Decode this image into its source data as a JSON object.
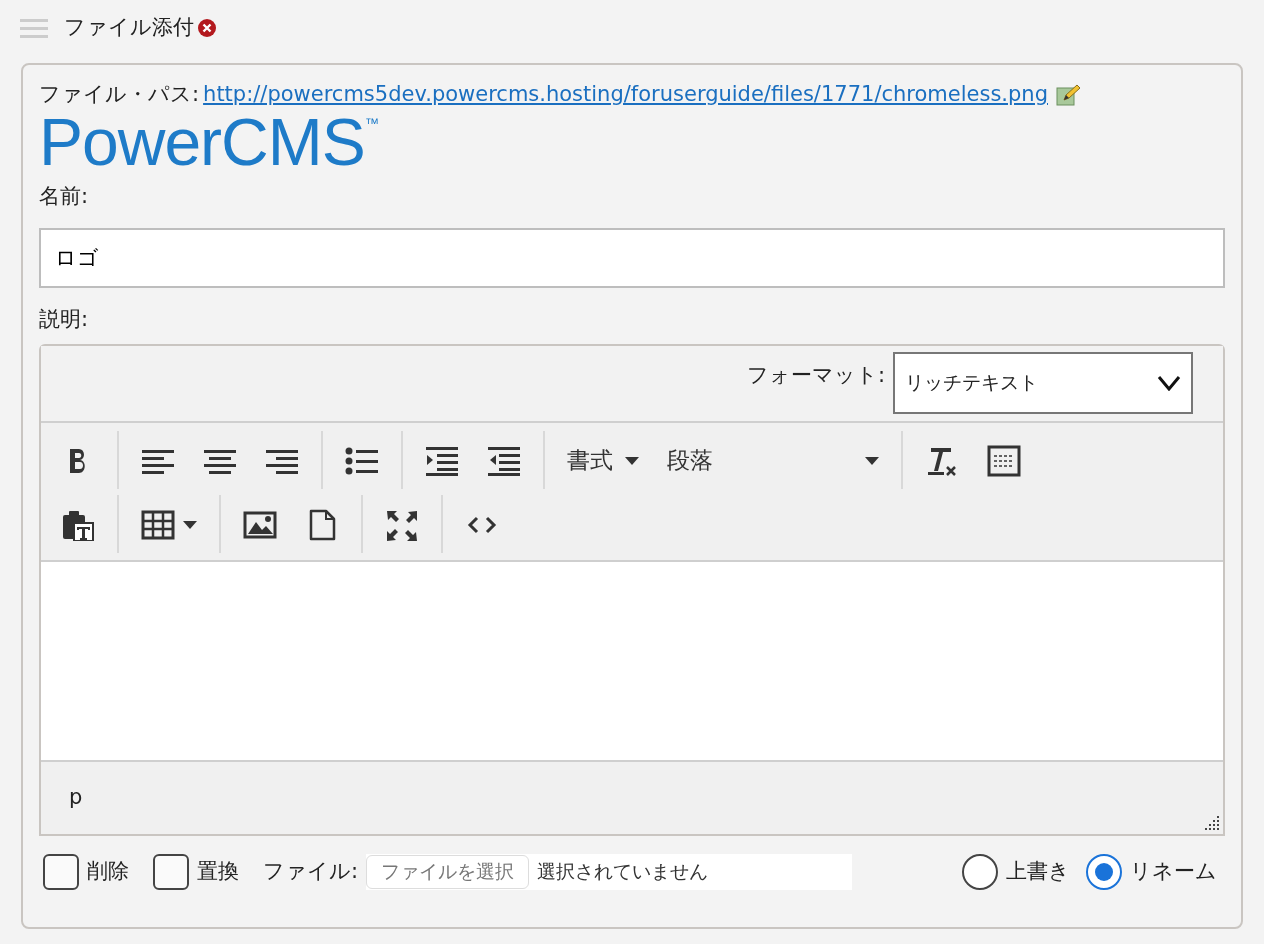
{
  "header": {
    "title": "ファイル添付"
  },
  "file_path": {
    "label": "ファイル・パス:",
    "url": "http://powercms5dev.powercms.hosting/foruserguide/files/1771/chromeless.png"
  },
  "preview_logo": {
    "text": "PowerCMS",
    "mark": "™"
  },
  "name_field": {
    "label": "名前:",
    "value": "ロゴ"
  },
  "description": {
    "label": "説明:",
    "format_label": "フォーマット:",
    "format_value": "リッチテキスト",
    "toolbar_menus": [
      "書式",
      "段落"
    ],
    "status_path": "p"
  },
  "options": [
    {
      "kind": "checkbox",
      "label": "削除",
      "checked": false
    },
    {
      "kind": "checkbox",
      "label": "置換",
      "checked": false
    }
  ],
  "file_input": {
    "label": "ファイル:",
    "button": "ファイルを選択",
    "status": "選択されていません"
  },
  "save_mode": [
    {
      "label": "上書き",
      "selected": false
    },
    {
      "label": "リネーム",
      "selected": true
    }
  ]
}
